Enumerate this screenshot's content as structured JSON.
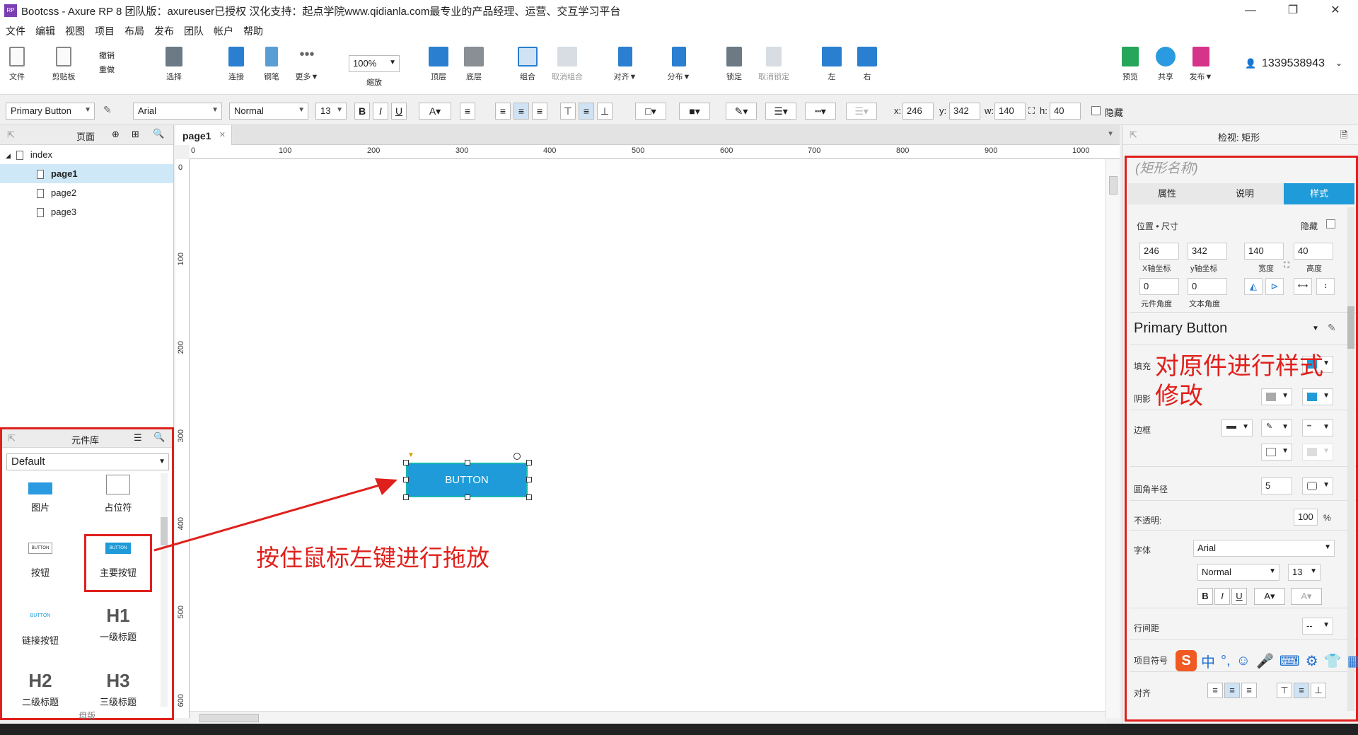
{
  "window": {
    "title": "Bootcss - Axure RP 8 团队版：axureuser已授权 汉化支持：起点学院www.qidianla.com最专业的产品经理、运营、交互学习平台",
    "minimize": "—",
    "maximize": "❐",
    "close": "✕"
  },
  "menu": [
    "文件",
    "编辑",
    "视图",
    "项目",
    "布局",
    "发布",
    "团队",
    "帐户",
    "帮助"
  ],
  "toolbar": {
    "file": "文件",
    "clipboard": "剪贴板",
    "undo": "撤销",
    "redo": "重做",
    "select": "选择",
    "connect": "连接",
    "pen": "钢笔",
    "more": "更多▼",
    "zoom_value": "100%",
    "zoom": "缩放",
    "top_layer": "顶层",
    "bottom_layer": "底层",
    "group": "组合",
    "ungroup": "取消组合",
    "align": "对齐▼",
    "distribute": "分布▼",
    "lock": "锁定",
    "unlock": "取消锁定",
    "left": "左",
    "right": "右",
    "preview": "预览",
    "share": "共享",
    "publish": "发布▼",
    "user": "1339538943"
  },
  "format": {
    "style": "Primary Button",
    "font": "Arial",
    "weight": "Normal",
    "size": "13",
    "x_label": "x:",
    "x": "246",
    "y_label": "y:",
    "y": "342",
    "w_label": "w:",
    "w": "140",
    "h_label": "h:",
    "h": "40",
    "hidden": "隐藏"
  },
  "pages": {
    "title": "页面",
    "items": [
      "index",
      "page1",
      "page2",
      "page3"
    ]
  },
  "library": {
    "title": "元件库",
    "selected": "Default",
    "items": [
      "图片",
      "占位符",
      "按钮",
      "主要按钮",
      "链接按钮",
      "一级标题",
      "二级标题",
      "三级标题"
    ],
    "btn_text": "BUTTON",
    "h1": "H1",
    "h2": "H2",
    "h3": "H3",
    "masters": "母版"
  },
  "canvas": {
    "tab": "page1",
    "tab_close": "✕",
    "ruler_x": [
      "0",
      "100",
      "200",
      "300",
      "400",
      "500",
      "600",
      "700",
      "800",
      "900",
      "1000"
    ],
    "ruler_y": [
      "0",
      "100",
      "200",
      "300",
      "400",
      "500",
      "600"
    ],
    "widget_text": "BUTTON",
    "annotation": "按住鼠标左键进行拖放"
  },
  "inspector": {
    "title": "检视: 矩形",
    "name_placeholder": "(矩形名称)",
    "tabs": [
      "属性",
      "说明",
      "样式"
    ],
    "position_size": "位置 • 尺寸",
    "hidden": "隐藏",
    "x": "246",
    "y": "342",
    "w": "140",
    "h": "40",
    "x_label": "X轴坐标",
    "y_label": "y轴坐标",
    "w_label": "宽度",
    "h_label": "高度",
    "rot": "0",
    "text_rot": "0",
    "rot_label": "元件角度",
    "text_rot_label": "文本角度",
    "style_name": "Primary Button",
    "fill": "填充",
    "shadow": "阴影",
    "border": "边框",
    "radius_label": "圆角半径",
    "radius": "5",
    "opacity_label": "不透明:",
    "opacity": "100",
    "percent": "%",
    "font_label": "字体",
    "font": "Arial",
    "weight": "Normal",
    "size": "13",
    "line_spacing": "行间距",
    "line_spacing_val": "--",
    "bullets": "项目符号",
    "align": "对齐",
    "note": "对原件进行样式修改"
  },
  "colors": {
    "accent": "#1e9bd8",
    "annotation": "#e0201c"
  }
}
